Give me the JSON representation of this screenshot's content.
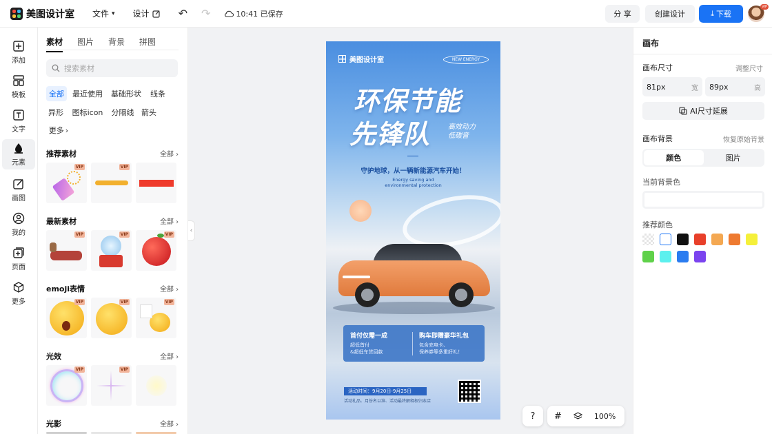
{
  "app": {
    "name": "美图设计室"
  },
  "topbar": {
    "file_menu": "文件",
    "design_menu": "设计",
    "save_status": "10:41 已保存",
    "share_label": "分 享",
    "create_label": "创建设计",
    "download_label": "下载",
    "avatar_badge": "VIP"
  },
  "rail": [
    {
      "label": "添加",
      "icon": "plus-square-icon"
    },
    {
      "label": "模板",
      "icon": "template-icon"
    },
    {
      "label": "文字",
      "icon": "text-icon"
    },
    {
      "label": "元素",
      "icon": "shapes-icon"
    },
    {
      "label": "画图",
      "icon": "edit-icon"
    },
    {
      "label": "我的",
      "icon": "user-icon"
    },
    {
      "label": "页面",
      "icon": "page-add-icon"
    },
    {
      "label": "更多",
      "icon": "cube-icon"
    }
  ],
  "panel": {
    "tabs": [
      "素材",
      "图片",
      "背景",
      "拼图"
    ],
    "search_placeholder": "搜索素材",
    "chips": [
      "全部",
      "最近使用",
      "基础形状",
      "线条",
      "异形",
      "图标icon",
      "分隔线",
      "箭头",
      "更多"
    ],
    "all_label": "全部",
    "vip": "VIP",
    "sections": [
      "推荐素材",
      "最新素材",
      "emoji表情",
      "光效",
      "光影"
    ]
  },
  "poster": {
    "brand": "美图设计室",
    "badge": "NEW ENERGY",
    "headline1": "环保节能",
    "headline2": "先锋队",
    "side_line1": "高效动力",
    "side_line2": "低碳音",
    "subtitle": "守护地球，从一辆新能源汽车开始！",
    "english_line1": "Energy saving and",
    "english_line2": "environmental protection",
    "offer_left_title": "首付仅需一成",
    "offer_left_line1": "超低首付",
    "offer_left_line2": "&超低车贷回款",
    "offer_right_title": "购车即赠豪华礼包",
    "offer_right_line1": "包含充电卡、",
    "offer_right_line2": "保养券等多重好礼！",
    "event_time": "活动时间：9月20日-9月25日",
    "event_note": "活动礼品、月份名以准、活动最终解释权归本店"
  },
  "canvas": {
    "zoom": "100%",
    "help": "?"
  },
  "right": {
    "title": "画布",
    "size_label": "画布尺寸",
    "adjust_link": "调整尺寸",
    "width_value": "81px",
    "width_unit": "宽",
    "height_value": "89px",
    "height_unit": "高",
    "ai_button": "AI尺寸延展",
    "bg_label": "画布背景",
    "restore_link": "恢复原始背景",
    "seg_color": "颜色",
    "seg_image": "图片",
    "current_bg_label": "当前背景色",
    "current_bg": "#ffffff",
    "recommend_label": "推荐颜色",
    "swatches": [
      "transparent",
      "#ffffff",
      "#111111",
      "#e8402a",
      "#f4a852",
      "#ee7a30",
      "#f5f03a",
      "#5fd14a",
      "#5cf0ee",
      "#2a7cf0",
      "#7b44ef"
    ]
  },
  "colors": {
    "accent": "#1a73f5"
  }
}
